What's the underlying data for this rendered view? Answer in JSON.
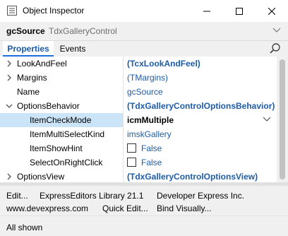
{
  "window": {
    "title": "Object Inspector"
  },
  "component": {
    "name": "gcSource",
    "class": "TdxGalleryControl"
  },
  "tabs": [
    {
      "label": "Properties",
      "active": true
    },
    {
      "label": "Events",
      "active": false
    }
  ],
  "properties": [
    {
      "name": "LookAndFeel",
      "value": "(TcxLookAndFeel)",
      "expand": "collapsed"
    },
    {
      "name": "Margins",
      "value": "(TMargins)",
      "expand": "collapsed"
    },
    {
      "name": "Name",
      "value": "gcSource",
      "expand": "none"
    },
    {
      "name": "OptionsBehavior",
      "value": "(TdxGalleryControlOptionsBehavior)",
      "expand": "expanded"
    },
    {
      "name": "ItemCheckMode",
      "value": "icmMultiple",
      "expand": "none",
      "selected": true
    },
    {
      "name": "ItemMultiSelectKind",
      "value": "imskGallery",
      "expand": "none"
    },
    {
      "name": "ItemShowHint",
      "value": "False",
      "expand": "none"
    },
    {
      "name": "SelectOnRightClick",
      "value": "False",
      "expand": "none"
    },
    {
      "name": "OptionsView",
      "value": "(TdxGalleryControlOptionsView)",
      "expand": "collapsed"
    }
  ],
  "verbs": {
    "edit": "Edit...",
    "library": "ExpressEditors Library 21.1",
    "vendor": "Developer Express Inc.",
    "website": "www.devexpress.com",
    "quick_edit": "Quick Edit...",
    "bind_visually": "Bind Visually..."
  },
  "status": "All shown",
  "colors": {
    "accent": "#1e6fd9",
    "value_text": "#1c5ca9",
    "selection": "#cce4f7"
  }
}
